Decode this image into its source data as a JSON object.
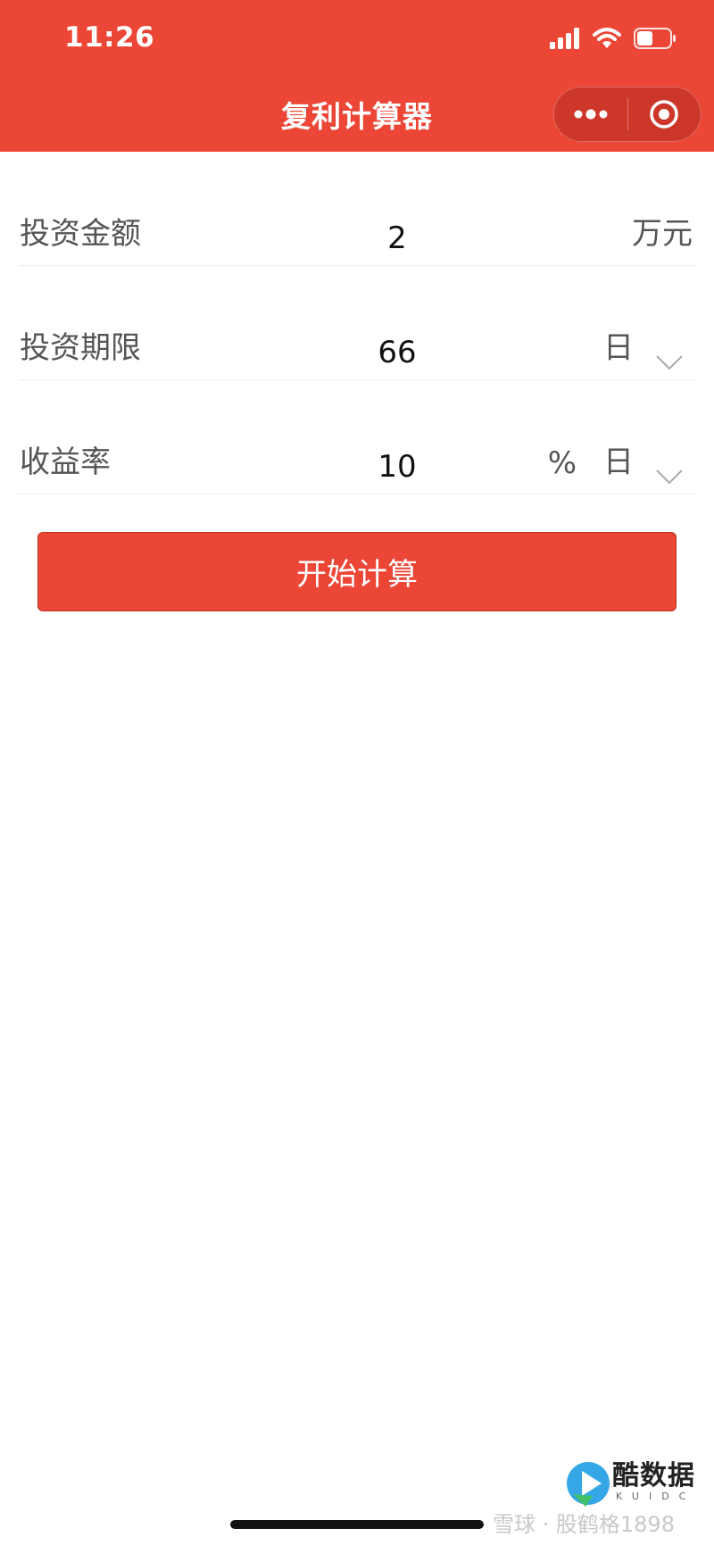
{
  "status_bar": {
    "time": "11:26"
  },
  "header": {
    "title": "复利计算器",
    "more_icon": "more-dots-icon",
    "close_icon": "target-circle-icon",
    "color": "#ec4636"
  },
  "form": {
    "rows": [
      {
        "label": "投资金额",
        "value": "2",
        "unit": "万元"
      },
      {
        "label": "投资期限",
        "value": "66",
        "unit": "日"
      },
      {
        "label": "收益率",
        "value": "10",
        "percent": "%",
        "unit": "日"
      }
    ]
  },
  "button": {
    "label": "开始计算"
  },
  "watermark": {
    "text": "雪球 · 股鹤格1898",
    "logo_text": "酷数据",
    "logo_sub": "KUIDC"
  }
}
